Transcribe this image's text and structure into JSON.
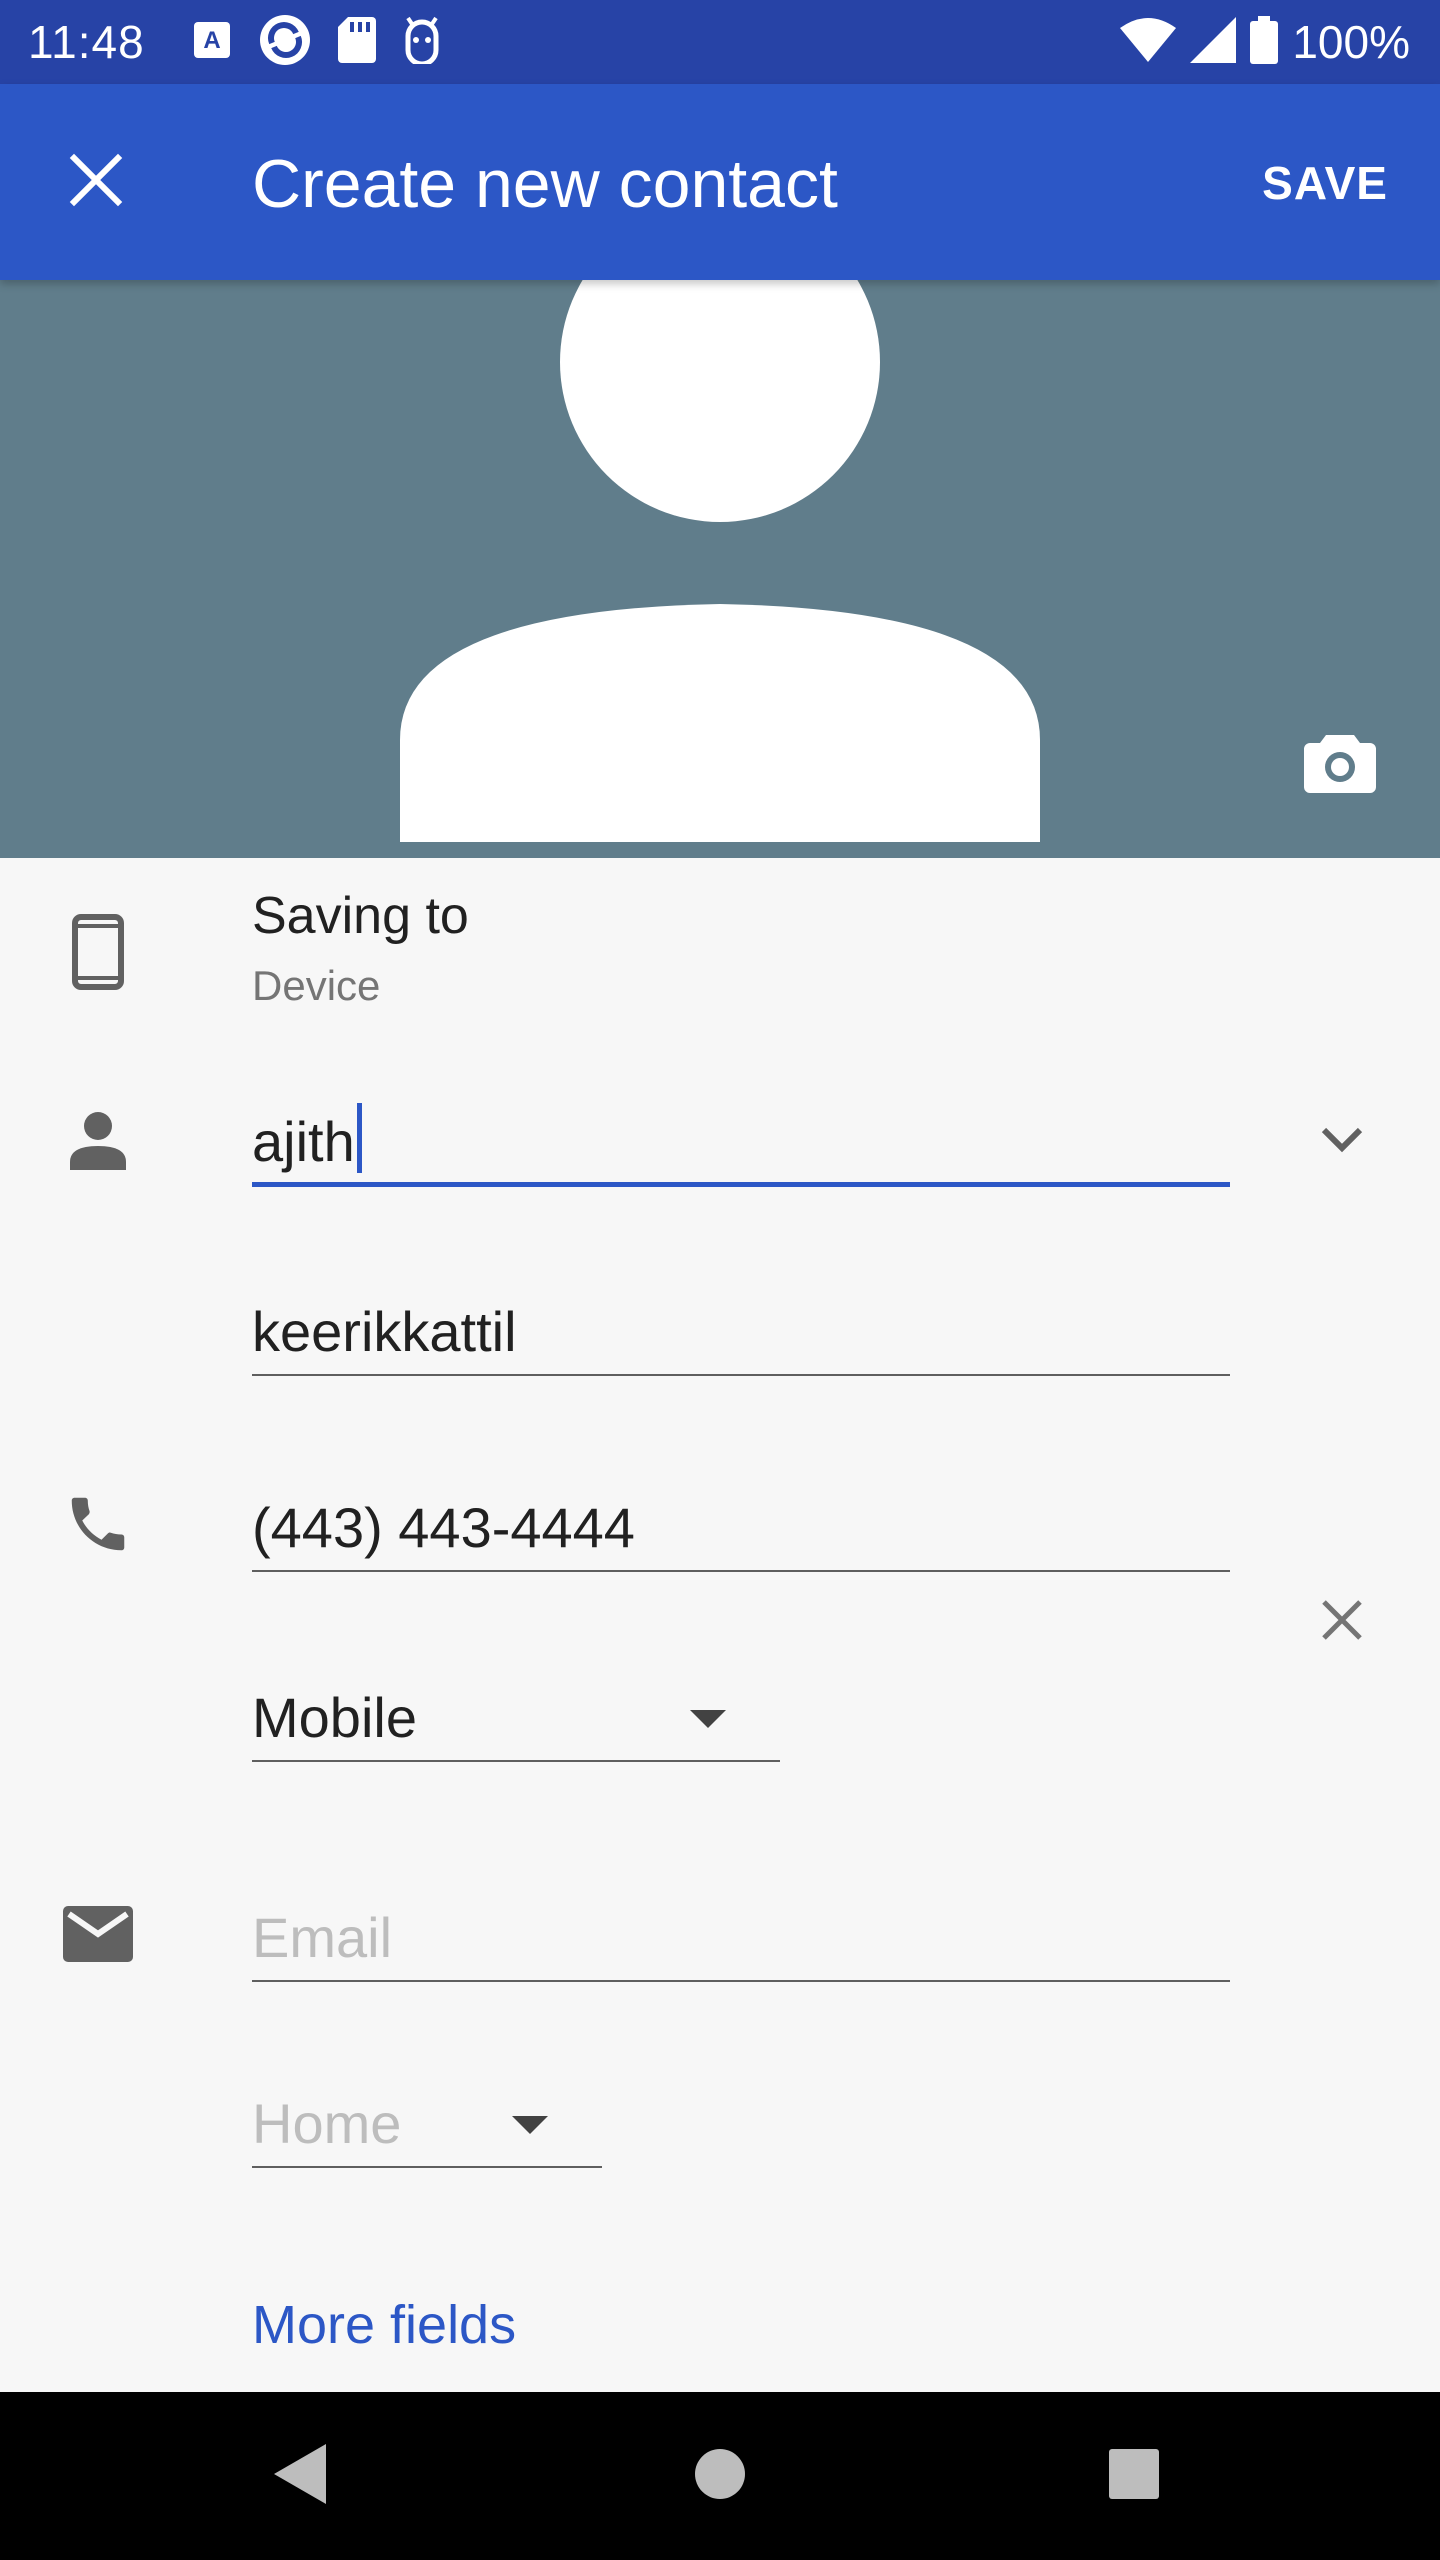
{
  "status_bar": {
    "time": "11:48",
    "battery": "100%",
    "left_icons": [
      "a-box-icon",
      "sync-icon",
      "sd-card-icon",
      "android-icon"
    ],
    "right_icons": [
      "wifi-icon",
      "signal-icon",
      "battery-icon"
    ]
  },
  "app_bar": {
    "title": "Create new contact",
    "save_label": "SAVE",
    "close_icon": "close-icon"
  },
  "photo": {
    "camera_icon": "camera-icon"
  },
  "saving_to": {
    "title": "Saving to",
    "account": "Device",
    "icon": "phone-device-icon"
  },
  "name": {
    "first_name": "ajith",
    "last_name": "keerikkattil",
    "icon": "person-icon",
    "expand_icon": "chevron-down-icon"
  },
  "phone": {
    "value": "(443) 443-4444",
    "type": "Mobile",
    "icon": "phone-icon",
    "remove_icon": "close-icon"
  },
  "email": {
    "placeholder": "Email",
    "type": "Home",
    "icon": "email-icon"
  },
  "more_fields_label": "More fields",
  "nav": {
    "back_icon": "back-icon",
    "home_icon": "home-icon",
    "recents_icon": "recents-icon"
  },
  "colors": {
    "status_bar": "#2743a6",
    "app_bar": "#2c57c6",
    "photo_bg": "#607d8b",
    "accent": "#2c57c6"
  }
}
